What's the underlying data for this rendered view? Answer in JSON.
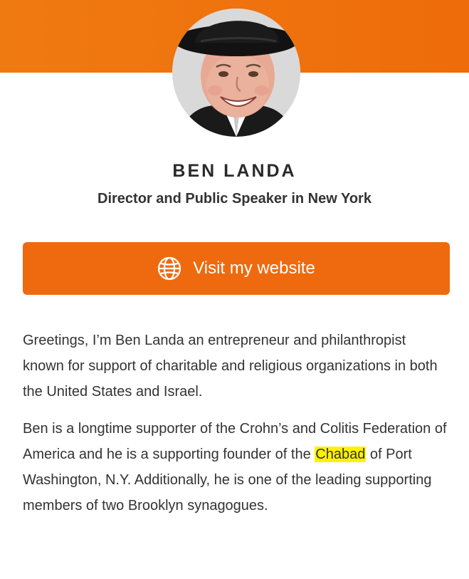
{
  "header": {
    "banner_color": "#ef6a0e",
    "avatar_icon": "profile-photo"
  },
  "profile": {
    "name": "BEN LANDA",
    "subtitle": "Director and Public Speaker in New York"
  },
  "cta": {
    "icon": "globe-icon",
    "label": "Visit my website",
    "color": "#ef6a0e"
  },
  "bio": {
    "p1": "Greetings, I’m Ben Landa an entrepreneur and philanthropist known for support of charitable and religious organizations in both the United States and Israel.",
    "p2_before": "Ben is a longtime supporter of the Crohn’s and Colitis Federation of America and he is a supporting founder of the ",
    "p2_highlight": "Chabad",
    "p2_after": " of Port Washington, N.Y. Additionally, he is one of the leading supporting members of two Brooklyn synagogues.",
    "highlight_color": "#fff200"
  }
}
